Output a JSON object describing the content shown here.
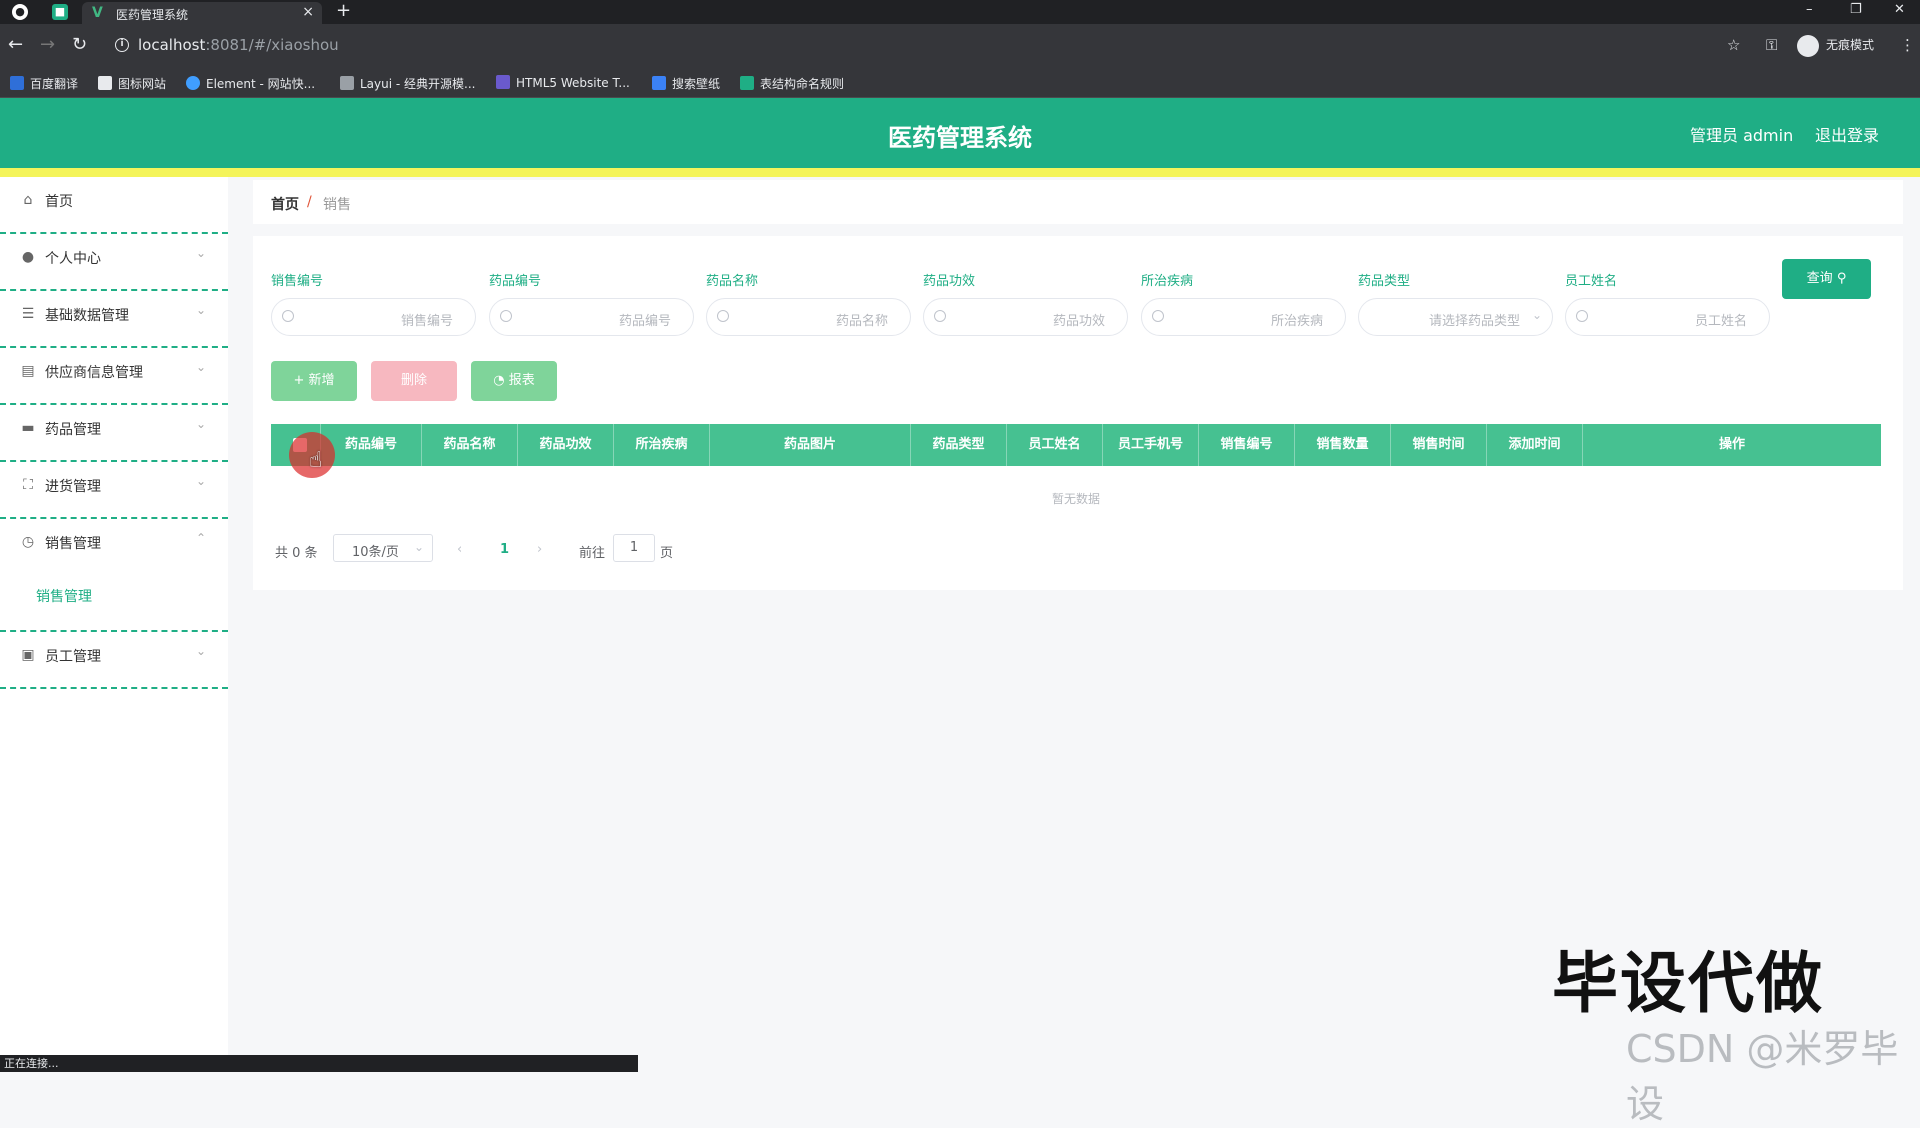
{
  "browser": {
    "tab_title": "医药管理系统",
    "url_host": "localhost",
    "url_rest": ":8081/#/xiaoshou",
    "incognito_label": "无痕模式",
    "bookmarks": [
      "百度翻译",
      "图标网站",
      "Element - 网站快...",
      "Layui - 经典开源模...",
      "HTML5 Website T...",
      "搜索壁纸",
      "表结构命名规则"
    ],
    "status_text": "正在连接..."
  },
  "header": {
    "title": "医药管理系统",
    "user_label": "管理员 admin",
    "logout_label": "退出登录",
    "color": "#1fae85"
  },
  "sidebar": {
    "items": [
      {
        "label": "首页",
        "icon": "home-icon"
      },
      {
        "label": "个人中心",
        "icon": "user-icon"
      },
      {
        "label": "基础数据管理",
        "icon": "list-icon"
      },
      {
        "label": "供应商信息管理",
        "icon": "box-icon"
      },
      {
        "label": "药品管理",
        "icon": "briefcase-icon"
      },
      {
        "label": "进货管理",
        "icon": "frame-icon"
      },
      {
        "label": "销售管理",
        "icon": "clock-icon"
      },
      {
        "label": "员工管理",
        "icon": "clipboard-icon"
      }
    ],
    "sub_item": "销售管理"
  },
  "breadcrumb": {
    "home": "首页",
    "sep": "/",
    "current": "销售"
  },
  "filters": [
    {
      "label": "销售编号",
      "placeholder": "销售编号"
    },
    {
      "label": "药品编号",
      "placeholder": "药品编号"
    },
    {
      "label": "药品名称",
      "placeholder": "药品名称"
    },
    {
      "label": "药品功效",
      "placeholder": "药品功效"
    },
    {
      "label": "所治疾病",
      "placeholder": "所治疾病"
    },
    {
      "label": "药品类型",
      "placeholder": "请选择药品类型"
    },
    {
      "label": "员工姓名",
      "placeholder": "员工姓名"
    }
  ],
  "query_label": "查询",
  "actions": {
    "add": "+ 新增",
    "delete": "删除",
    "report": "报表"
  },
  "table": {
    "columns": [
      "药品编号",
      "药品名称",
      "药品功效",
      "所治疾病",
      "药品图片",
      "药品类型",
      "员工姓名",
      "员工手机号",
      "销售编号",
      "销售数量",
      "销售时间",
      "添加时间",
      "操作"
    ],
    "empty_text": "暂无数据"
  },
  "pagination": {
    "total": "共 0 条",
    "page_size": "10条/页",
    "current": "1",
    "goto_label": "前往",
    "goto_value": "1",
    "page_suffix": "页"
  },
  "overlay": {
    "watermark": "毕设代做",
    "credit": "CSDN @米罗毕设"
  }
}
